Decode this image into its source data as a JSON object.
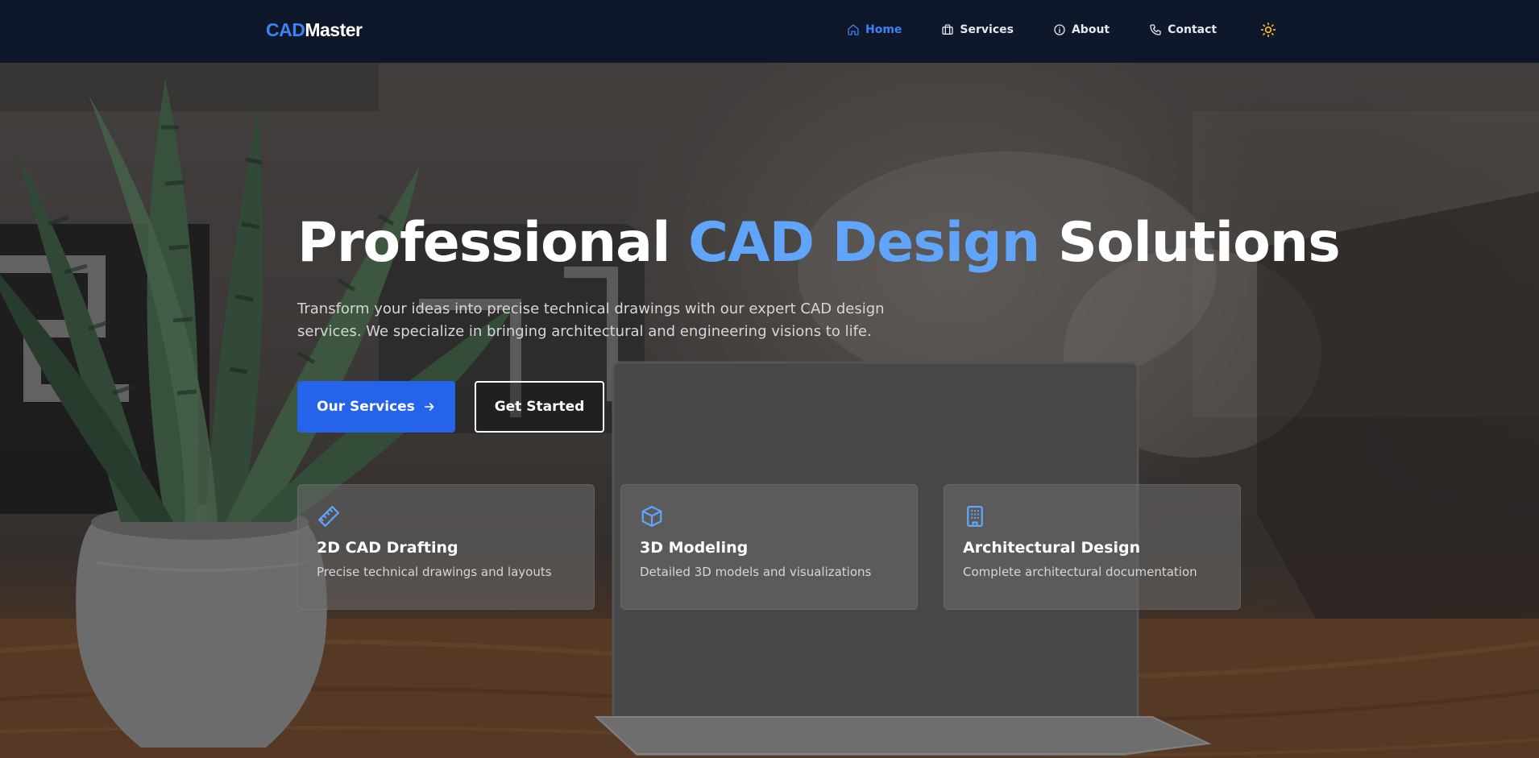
{
  "brand": {
    "prefix": "CAD",
    "suffix": "Master"
  },
  "nav": {
    "items": [
      {
        "label": "Home",
        "icon": "home-icon",
        "active": true
      },
      {
        "label": "Services",
        "icon": "briefcase-icon"
      },
      {
        "label": "About",
        "icon": "info-icon"
      },
      {
        "label": "Contact",
        "icon": "phone-icon"
      }
    ],
    "theme_toggle_icon": "sun-icon"
  },
  "hero": {
    "title_before": "Professional",
    "title_highlight": "CAD Design",
    "title_after": "Solutions",
    "subtitle": "Transform your ideas into precise technical drawings with our expert CAD design services. We specialize in bringing architectural and engineering visions to life.",
    "primary_button": "Our Services",
    "primary_button_icon": "arrow-right-icon",
    "secondary_button": "Get Started",
    "background": "photo of a snake plant in a pot beside a laptop on a wooden desk"
  },
  "features": [
    {
      "icon": "ruler-icon",
      "title": "2D CAD Drafting",
      "description": "Precise technical drawings and layouts"
    },
    {
      "icon": "box-icon",
      "title": "3D Modeling",
      "description": "Detailed 3D models and visualizations"
    },
    {
      "icon": "building-icon",
      "title": "Architectural Design",
      "description": "Complete architectural documentation"
    }
  ],
  "colors": {
    "navbar_bg": "#0f172a",
    "accent": "#3b82f6",
    "highlight": "#60a5fa",
    "primary_button": "#2563eb",
    "theme_icon": "#fbbf24"
  }
}
